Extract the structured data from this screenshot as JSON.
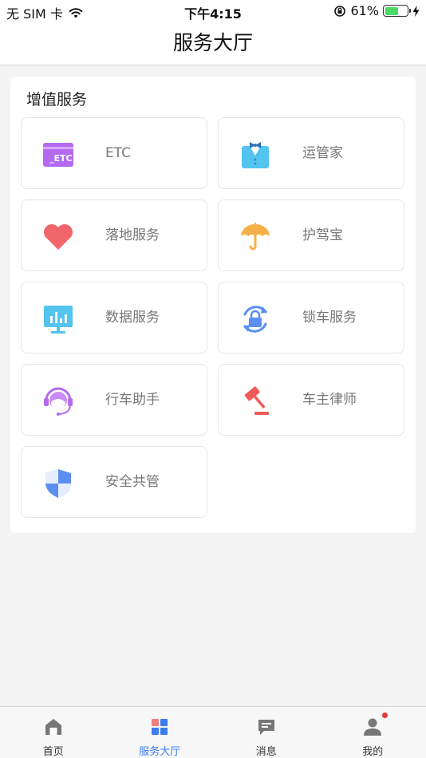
{
  "status_bar": {
    "carrier": "无 SIM 卡",
    "time": "下午4:15",
    "battery_percent": "61%",
    "battery_level": 0.61
  },
  "header": {
    "title": "服务大厅"
  },
  "section": {
    "title": "增值服务",
    "items": [
      {
        "label": "ETC",
        "icon": "etc-card-icon",
        "color": "#b36af0"
      },
      {
        "label": "运管家",
        "icon": "butler-suit-icon",
        "color": "#52c4ee"
      },
      {
        "label": "落地服务",
        "icon": "heart-icon",
        "color": "#f0666a"
      },
      {
        "label": "护驾宝",
        "icon": "umbrella-icon",
        "color": "#f5b04a"
      },
      {
        "label": "数据服务",
        "icon": "monitor-chart-icon",
        "color": "#52c4ee"
      },
      {
        "label": "锁车服务",
        "icon": "lock-refresh-icon",
        "color": "#5a8ef0"
      },
      {
        "label": "行车助手",
        "icon": "headset-assistant-icon",
        "color": "#b36af0"
      },
      {
        "label": "车主律师",
        "icon": "gavel-icon",
        "color": "#ee5a5a"
      },
      {
        "label": "安全共管",
        "icon": "shield-icon",
        "color": "#5a8ef0"
      }
    ]
  },
  "tabbar": {
    "active": "服务大厅",
    "accent": "#3d7cf0",
    "items": [
      {
        "label": "首页",
        "icon": "home-icon"
      },
      {
        "label": "服务大厅",
        "icon": "grid-icon"
      },
      {
        "label": "消息",
        "icon": "message-icon"
      },
      {
        "label": "我的",
        "icon": "user-icon",
        "badge": true
      }
    ]
  }
}
